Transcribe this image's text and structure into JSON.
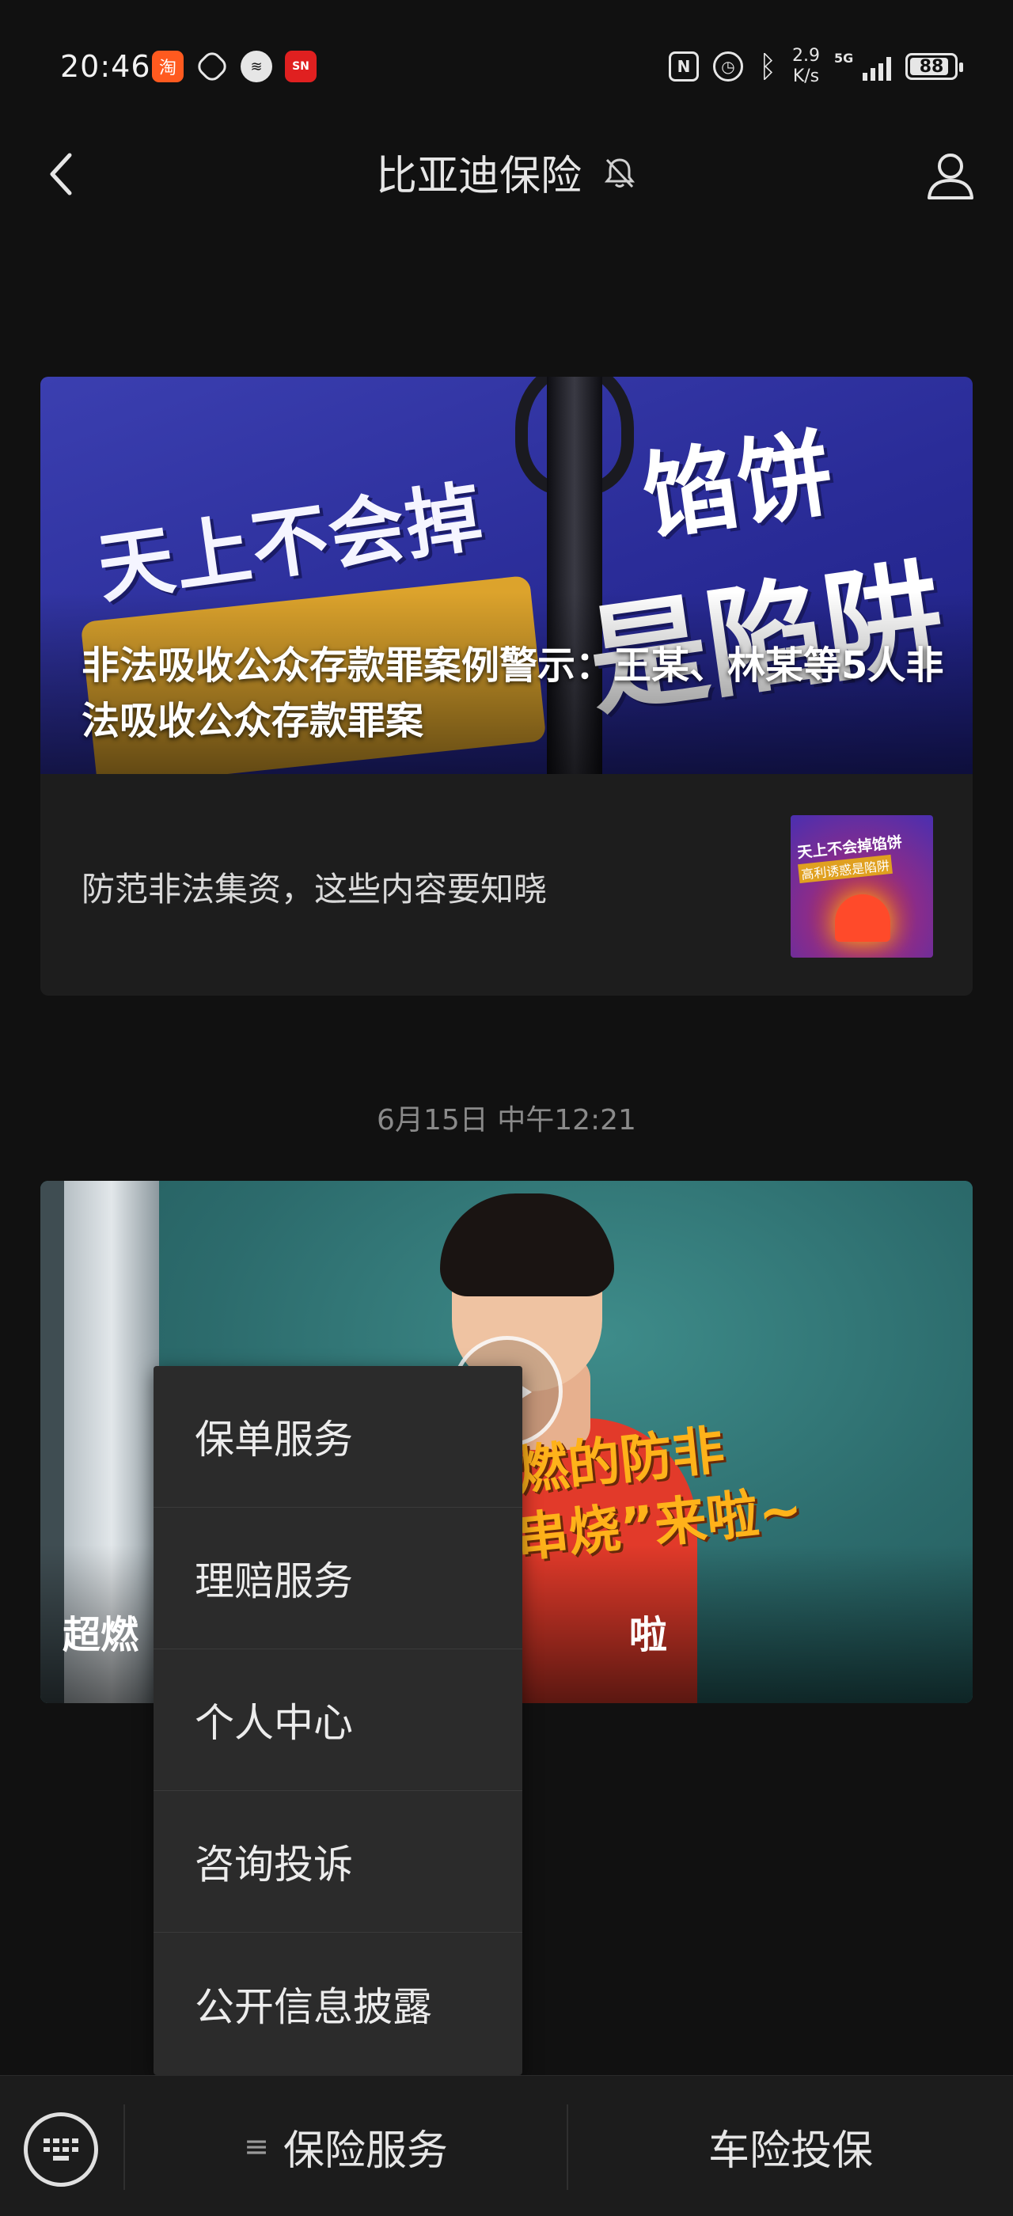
{
  "status_bar": {
    "time": "20:46",
    "app_icons": [
      "taobao-icon",
      "hand-icon",
      "voice-icon",
      "suning-icon"
    ],
    "net_speed_value": "2.9",
    "net_speed_unit": "K/s",
    "network": "5G",
    "battery": "88",
    "battery_level": 0.88
  },
  "title_bar": {
    "title": "比亚迪保险",
    "muted": true
  },
  "article_card": {
    "banner_text_1": "天上不会掉",
    "banner_text_2": "馅饼",
    "banner_text_3": "是陷阱",
    "headline": "非法吸收公众存款罪案例警示：王某、林某等5人非法吸收公众存款罪案",
    "sub_item_title": "防范非法集资，这些内容要知晓",
    "thumb_text_1": "天上不会掉馅饼",
    "thumb_text_2": "高利诱惑是陷阱"
  },
  "timestamp": "6月15日 中午12:21",
  "video_card": {
    "overlay_line_1": "燃的防非",
    "overlay_line_2": "串烧”来啦~",
    "title_visible_left": "超燃",
    "title_visible_right": "啦"
  },
  "popup_menu": {
    "items": [
      "保单服务",
      "理赔服务",
      "个人中心",
      "咨询投诉",
      "公开信息披露"
    ]
  },
  "bottom_menu": {
    "item_1": "保险服务",
    "item_1_glyph": "≡",
    "item_2": "车险投保"
  },
  "colors": {
    "background": "#111111",
    "card": "#1d1d1d",
    "popup": "#2b2b2b",
    "bottom_bar": "#1c1c1c",
    "timestamp": "#8a8a8a"
  }
}
